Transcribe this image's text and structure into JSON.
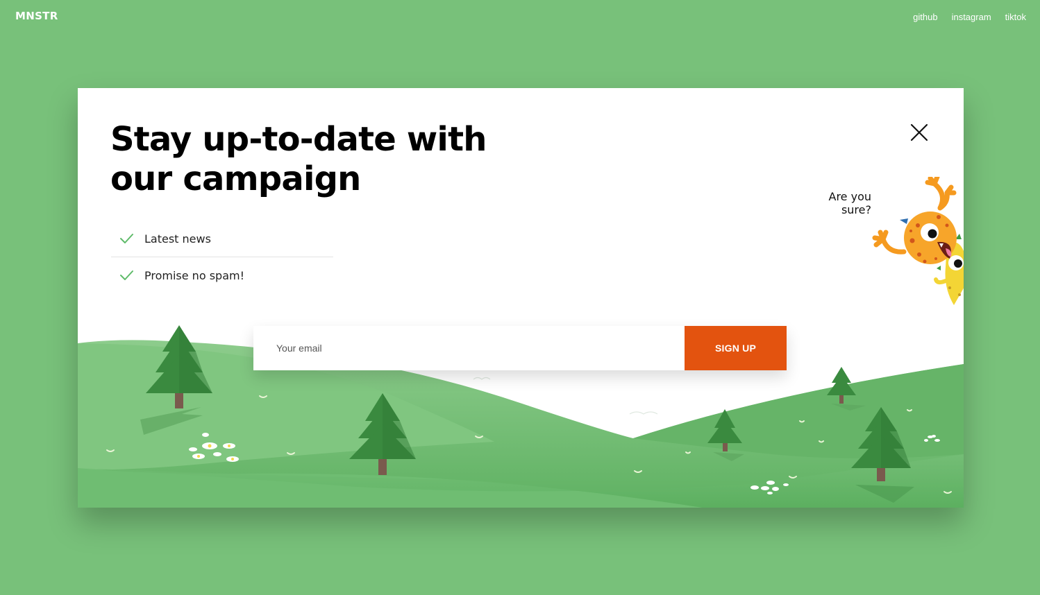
{
  "brand": {
    "logo": "MNSTR"
  },
  "nav": {
    "items": [
      {
        "label": "github"
      },
      {
        "label": "instagram"
      },
      {
        "label": "tiktok"
      }
    ]
  },
  "modal": {
    "title_line1": "Stay up-to-date with",
    "title_line2": "our campaign",
    "features": [
      {
        "label": "Latest news"
      },
      {
        "label": "Promise no spam!"
      }
    ],
    "sure_line1": "Are you",
    "sure_line2": "sure?",
    "email_placeholder": "Your email",
    "signup_label": "SIGN UP"
  },
  "colors": {
    "page_background": "#78c17a",
    "accent_button": "#e3530f",
    "check_green": "#5fbb6a",
    "tree_green": "#3a8a3f"
  },
  "icons": {
    "close": "close-icon",
    "check": "check-icon"
  }
}
